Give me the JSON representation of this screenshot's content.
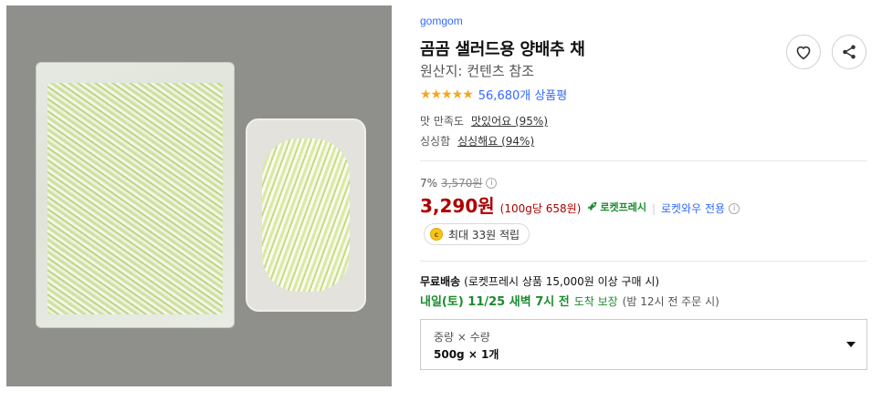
{
  "product": {
    "brand": "gomgom",
    "title": "곰곰 샐러드용 양배추 채",
    "origin": "원산지: 컨텐츠 참조",
    "rating_stars": "★★★★★",
    "rating_count": "56,680개 상품평"
  },
  "survey": {
    "taste_label": "맛 만족도",
    "taste_value": "맛있어요 (95%)",
    "fresh_label": "싱싱함",
    "fresh_value": "싱싱해요 (94%)"
  },
  "pricing": {
    "discount": "7%",
    "original_price": "3,570원",
    "price": "3,290원",
    "unit_price": "(100g당 658원)",
    "rocket_label": "로켓프레시",
    "wow_label": "로켓와우 전용",
    "info_glyph": "i"
  },
  "points": {
    "coin_glyph": "c",
    "text": "최대 33원 적립"
  },
  "shipping": {
    "free_label": "무료배송",
    "condition": "(로켓프레시 상품 15,000원 이상 구매 시)",
    "date": "내일(토) 11/25 새벽 7시 전",
    "guarantee": "도착 보장",
    "cutoff": "(밤 12시 전 주문 시)"
  },
  "option": {
    "label": "중량 × 수량",
    "value": "500g × 1개"
  },
  "icons": {
    "heart": "heart-icon",
    "share": "share-icon",
    "rocket": "rocket-icon",
    "coin": "coin-icon",
    "caret": "chevron-down-icon"
  },
  "colors": {
    "brand_link": "#346aff",
    "price_red": "#ae0000",
    "rocket_green": "#1a8c2e",
    "star": "#f5a623"
  }
}
